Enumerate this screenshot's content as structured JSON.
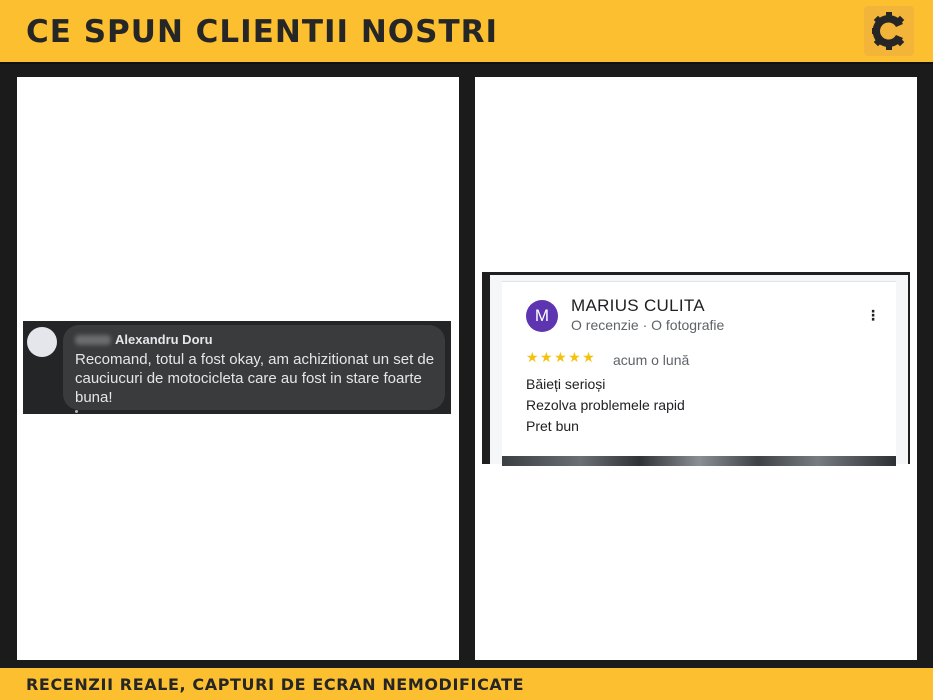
{
  "header": {
    "title": "CE SPUN CLIENTII NOSTRI",
    "logo_icon": "c-gear-logo-icon"
  },
  "reviews": {
    "facebook": {
      "author_last_name": "Alexandru Doru",
      "text": "Recomand, totul a fost okay, am achizitionat un set de cauciucuri de motocicleta care au fost in stare foarte buna!"
    },
    "google": {
      "avatar_letter": "M",
      "avatar_color": "#5e35b1",
      "author": "MARIUS CULITA",
      "meta": "O recenzie · O fotografie",
      "stars": "★★★★★",
      "rating": 5,
      "date": "acum o lună",
      "lines": [
        "Băieți serioși",
        "Rezolva problemele rapid",
        "Pret bun"
      ]
    }
  },
  "footer": {
    "text": "RECENZII REALE, CAPTURI DE ECRAN NEMODIFICATE"
  },
  "colors": {
    "accent": "#fbbf2f",
    "background": "#1b1b1b",
    "star": "#f4c20d"
  }
}
